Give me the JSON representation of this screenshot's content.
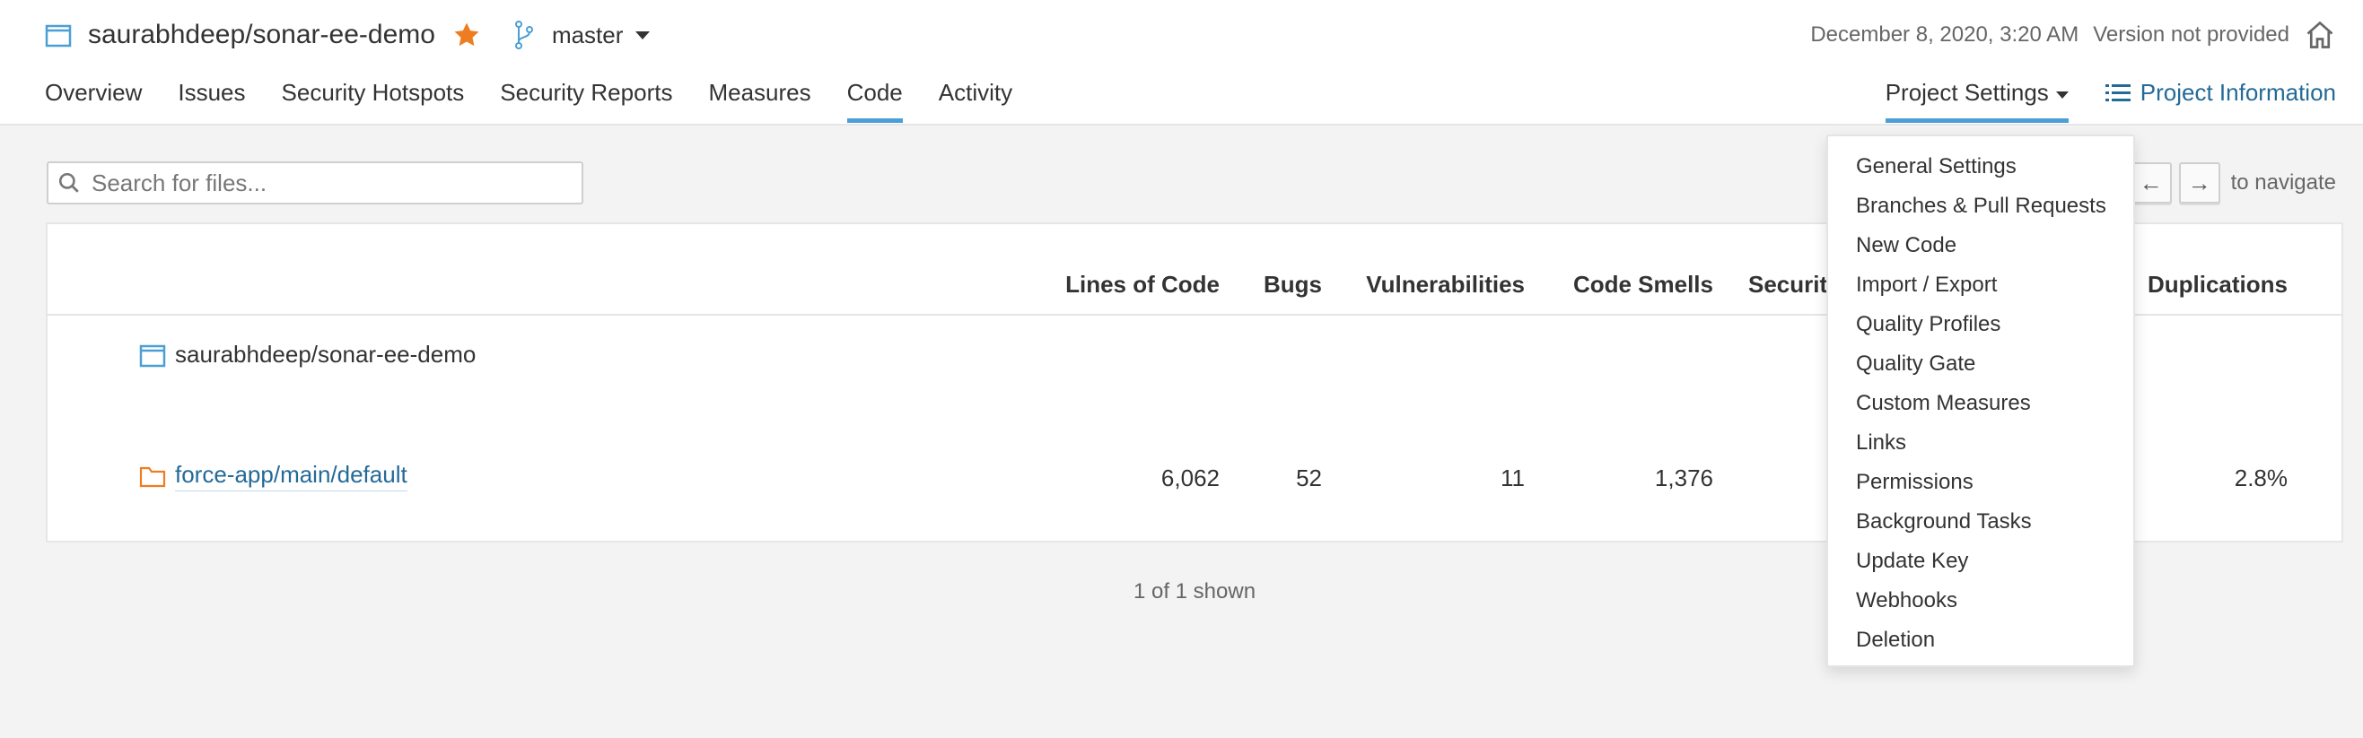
{
  "header": {
    "project_name": "saurabhdeep/sonar-ee-demo",
    "branch": "master",
    "date": "December 8, 2020, 3:20 AM",
    "version": "Version not provided"
  },
  "nav": {
    "tabs": [
      "Overview",
      "Issues",
      "Security Hotspots",
      "Security Reports",
      "Measures",
      "Code",
      "Activity"
    ],
    "active_tab": "Code",
    "project_settings": "Project Settings",
    "project_information": "Project Information"
  },
  "search": {
    "placeholder": "Search for files..."
  },
  "keyboard_hint": {
    "left_key": "←",
    "right_key": "→",
    "label": "to navigate"
  },
  "table": {
    "columns": [
      "Lines of Code",
      "Bugs",
      "Vulnerabilities",
      "Code Smells",
      "Securit",
      "Duplications"
    ],
    "project_row": {
      "name": "saurabhdeep/sonar-ee-demo"
    },
    "rows": [
      {
        "name": "force-app/main/default",
        "lines_of_code": "6,062",
        "bugs": "52",
        "vulnerabilities": "11",
        "code_smells": "1,376",
        "duplications": "2.8%"
      }
    ]
  },
  "footer": {
    "shown": "1 of 1 shown"
  },
  "settings_menu": {
    "items": [
      "General Settings",
      "Branches & Pull Requests",
      "New Code",
      "Import / Export",
      "Quality Profiles",
      "Quality Gate",
      "Custom Measures",
      "Links",
      "Permissions",
      "Background Tasks",
      "Update Key",
      "Webhooks",
      "Deletion"
    ]
  },
  "colors": {
    "accent": "#4b9fd5",
    "link": "#236a97",
    "star": "#ed7d20",
    "folder": "#ed7d20",
    "project_icon": "#4b9fd5"
  },
  "icons": {
    "project": "project-icon",
    "star": "star-icon",
    "branch": "branch-icon",
    "home": "home-icon",
    "list": "list-icon",
    "search": "search-icon",
    "folder": "folder-icon"
  }
}
